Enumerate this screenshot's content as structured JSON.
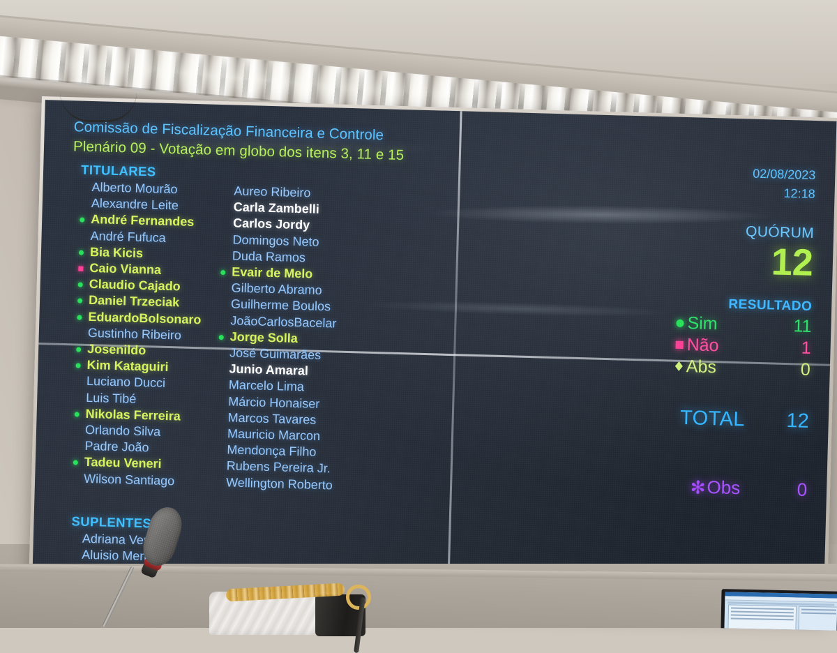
{
  "screen": {
    "header": {
      "committee": "Comissão de Fiscalização Financeira e Controle",
      "session": "Plenário 09 - Votação em globo dos itens 3, 11 e 15"
    },
    "sections": {
      "titulares_label": "TITULARES",
      "suplentes_label": "SUPLENTES"
    },
    "column_a": [
      {
        "name": "Alberto Mourão",
        "status": "absent",
        "marker": "none"
      },
      {
        "name": "Alexandre Leite",
        "status": "absent",
        "marker": "none"
      },
      {
        "name": "André Fernandes",
        "status": "voted",
        "marker": "sim"
      },
      {
        "name": "André Fufuca",
        "status": "absent",
        "marker": "none"
      },
      {
        "name": "Bia Kicis",
        "status": "voted",
        "marker": "sim"
      },
      {
        "name": "Caio Vianna",
        "status": "voted",
        "marker": "nao"
      },
      {
        "name": "Claudio Cajado",
        "status": "voted",
        "marker": "sim"
      },
      {
        "name": "Daniel Trzeciak",
        "status": "voted",
        "marker": "sim"
      },
      {
        "name": "EduardoBolsonaro",
        "status": "voted",
        "marker": "sim"
      },
      {
        "name": "Gustinho Ribeiro",
        "status": "absent",
        "marker": "none"
      },
      {
        "name": "Josenildo",
        "status": "voted",
        "marker": "sim"
      },
      {
        "name": "Kim Kataguiri",
        "status": "voted",
        "marker": "sim"
      },
      {
        "name": "Luciano Ducci",
        "status": "absent",
        "marker": "none"
      },
      {
        "name": "Luis Tibé",
        "status": "absent",
        "marker": "none"
      },
      {
        "name": "Nikolas Ferreira",
        "status": "voted",
        "marker": "sim"
      },
      {
        "name": "Orlando Silva",
        "status": "absent",
        "marker": "none"
      },
      {
        "name": "Padre João",
        "status": "absent",
        "marker": "none"
      },
      {
        "name": "Tadeu Veneri",
        "status": "voted",
        "marker": "sim"
      },
      {
        "name": "Wilson Santiago",
        "status": "absent",
        "marker": "none"
      }
    ],
    "column_b": [
      {
        "name": "Aureo Ribeiro",
        "status": "absent",
        "marker": "none"
      },
      {
        "name": "Carla Zambelli",
        "status": "present",
        "marker": "none"
      },
      {
        "name": "Carlos Jordy",
        "status": "present",
        "marker": "none"
      },
      {
        "name": "Domingos Neto",
        "status": "absent",
        "marker": "none"
      },
      {
        "name": "Duda Ramos",
        "status": "absent",
        "marker": "none"
      },
      {
        "name": "Evair de Melo",
        "status": "voted",
        "marker": "sim"
      },
      {
        "name": "Gilberto Abramo",
        "status": "absent",
        "marker": "none"
      },
      {
        "name": "Guilherme Boulos",
        "status": "absent",
        "marker": "none"
      },
      {
        "name": "JoãoCarlosBacelar",
        "status": "absent",
        "marker": "none"
      },
      {
        "name": "Jorge Solla",
        "status": "voted",
        "marker": "sim"
      },
      {
        "name": "José Guimarães",
        "status": "absent",
        "marker": "none"
      },
      {
        "name": "Junio Amaral",
        "status": "present",
        "marker": "none"
      },
      {
        "name": "Marcelo Lima",
        "status": "absent",
        "marker": "none"
      },
      {
        "name": "Márcio Honaiser",
        "status": "absent",
        "marker": "none"
      },
      {
        "name": "Marcos Tavares",
        "status": "absent",
        "marker": "none"
      },
      {
        "name": "Mauricio Marcon",
        "status": "absent",
        "marker": "none"
      },
      {
        "name": "Mendonça Filho",
        "status": "absent",
        "marker": "none"
      },
      {
        "name": "Rubens Pereira Jr.",
        "status": "absent",
        "marker": "none"
      },
      {
        "name": "Wellington Roberto",
        "status": "absent",
        "marker": "none"
      }
    ],
    "suplentes": [
      {
        "name": "Adriana Vent",
        "status": "absent",
        "marker": "none"
      },
      {
        "name": "Aluisio Men",
        "status": "absent",
        "marker": "none"
      }
    ],
    "info": {
      "date": "02/08/2023",
      "time": "12:18",
      "quorum_label": "QUÓRUM",
      "quorum_value": "12",
      "resultado_label": "RESULTADO",
      "rows": [
        {
          "icon": "circle-marker-icon",
          "label": "Sim",
          "value": "11"
        },
        {
          "icon": "square-marker-icon",
          "label": "Não",
          "value": "1"
        },
        {
          "icon": "diamond-marker-icon",
          "label": "Abs",
          "value": "0"
        }
      ],
      "total_label": "TOTAL",
      "total_value": "12",
      "obs_icon": "✻",
      "obs_label": "Obs",
      "obs_value": "0"
    },
    "colors": {
      "header_blue": "#5cc3ff",
      "header_green": "#b7ef5c",
      "name_absent": "#96c9ff",
      "name_present": "#ffffff",
      "name_voted": "#d7f25e",
      "marker_sim": "#27e05a",
      "marker_nao": "#ff3f95",
      "marker_abs": "#cdf07a",
      "total_blue": "#33b5ff",
      "obs_purple": "#a852ff"
    }
  }
}
